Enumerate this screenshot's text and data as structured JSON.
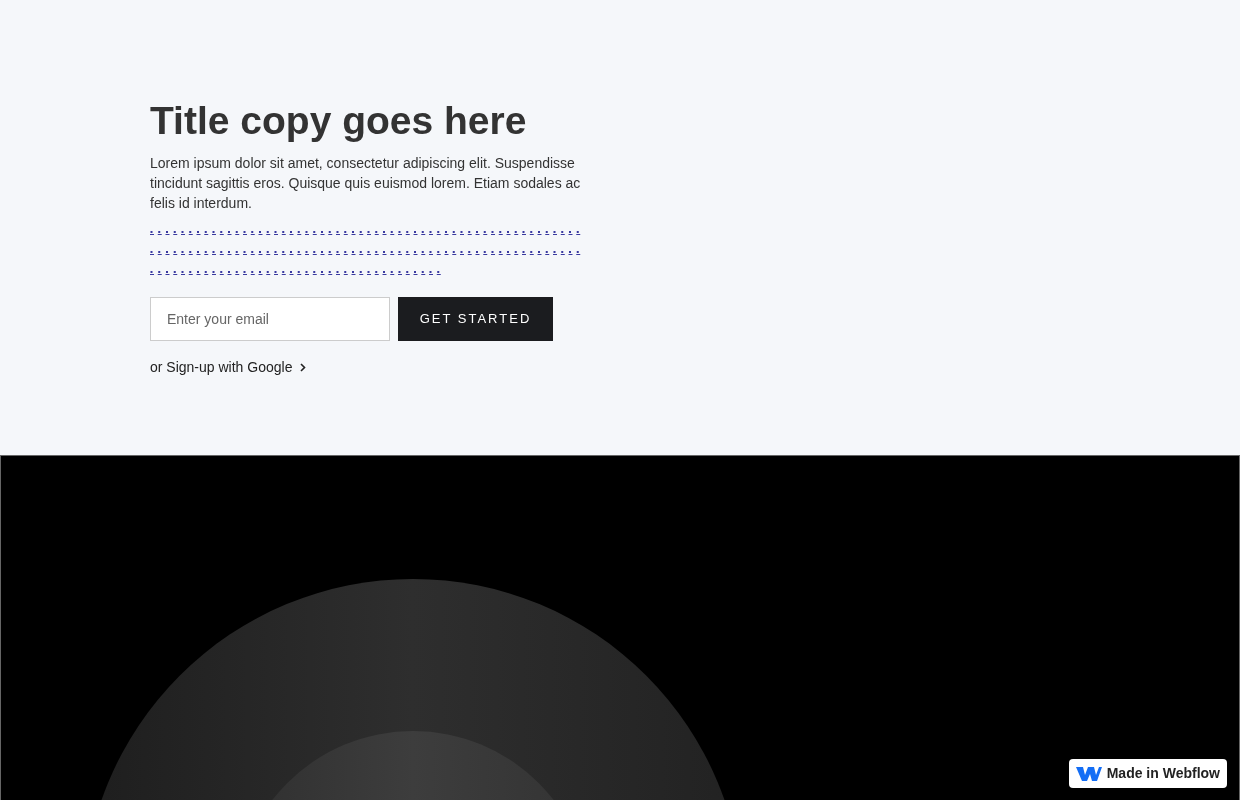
{
  "hero": {
    "title": "Title copy goes here",
    "description": "Lorem ipsum dolor sit amet, consectetur adipiscing elit. Suspendisse tincidunt sagittis eros. Quisque quis euismod lorem. Etiam sodales ac felis id interdum.",
    "email": {
      "placeholder": "Enter your email"
    },
    "button": "GET STARTED",
    "google_link": "or Sign-up with Google"
  },
  "badge": {
    "text": "Made in Webflow"
  }
}
